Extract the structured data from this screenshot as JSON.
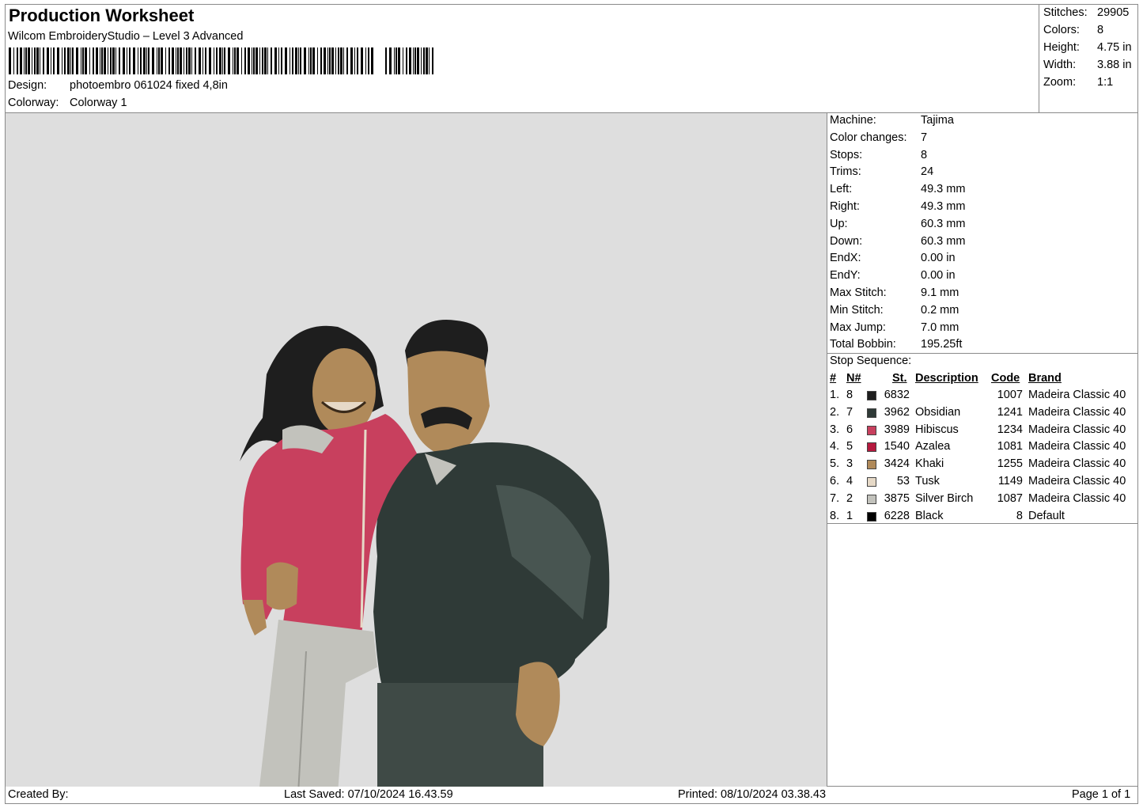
{
  "header": {
    "title": "Production Worksheet",
    "subtitle": "Wilcom EmbroideryStudio – Level 3 Advanced",
    "design_label": "Design:",
    "design_value": "photoembro 061024 fixed  4,8in",
    "colorway_label": "Colorway:",
    "colorway_value": "Colorway 1"
  },
  "stats": [
    {
      "label": "Stitches:",
      "value": "29905"
    },
    {
      "label": "Colors:",
      "value": "8"
    },
    {
      "label": "Height:",
      "value": "4.75 in"
    },
    {
      "label": "Width:",
      "value": "3.88 in"
    },
    {
      "label": "Zoom:",
      "value": "1:1"
    }
  ],
  "machine_info": [
    {
      "label": "Machine:",
      "value": "Tajima"
    },
    {
      "label": "Color changes:",
      "value": "7"
    },
    {
      "label": "Stops:",
      "value": "8"
    },
    {
      "label": "Trims:",
      "value": "24"
    },
    {
      "label": "Left:",
      "value": "49.3 mm"
    },
    {
      "label": "Right:",
      "value": "49.3 mm"
    },
    {
      "label": "Up:",
      "value": "60.3 mm"
    },
    {
      "label": "Down:",
      "value": "60.3 mm"
    },
    {
      "label": "EndX:",
      "value": "0.00 in"
    },
    {
      "label": "EndY:",
      "value": "0.00 in"
    },
    {
      "label": "Max Stitch:",
      "value": "9.1 mm"
    },
    {
      "label": "Min Stitch:",
      "value": "0.2 mm"
    },
    {
      "label": "Max Jump:",
      "value": "7.0 mm"
    },
    {
      "label": "Total Bobbin:",
      "value": "195.25ft"
    }
  ],
  "stop_sequence": {
    "title": "Stop Sequence:",
    "headers": {
      "num": "#",
      "n": "N#",
      "st": "St.",
      "description": "Description",
      "code": "Code",
      "brand": "Brand"
    },
    "rows": [
      {
        "num": "1.",
        "n": "8",
        "color": "#1e1e1e",
        "st": "6832",
        "description": "",
        "code": "1007",
        "brand": "Madeira Classic 40"
      },
      {
        "num": "2.",
        "n": "7",
        "color": "#2f3a37",
        "st": "3962",
        "description": "Obsidian",
        "code": "1241",
        "brand": "Madeira Classic 40"
      },
      {
        "num": "3.",
        "n": "6",
        "color": "#c8405e",
        "st": "3989",
        "description": "Hibiscus",
        "code": "1234",
        "brand": "Madeira Classic 40"
      },
      {
        "num": "4.",
        "n": "5",
        "color": "#b5193e",
        "st": "1540",
        "description": "Azalea",
        "code": "1081",
        "brand": "Madeira Classic 40"
      },
      {
        "num": "5.",
        "n": "3",
        "color": "#b08a5a",
        "st": "3424",
        "description": "Khaki",
        "code": "1255",
        "brand": "Madeira Classic 40"
      },
      {
        "num": "6.",
        "n": "4",
        "color": "#e6d9c7",
        "st": "53",
        "description": "Tusk",
        "code": "1149",
        "brand": "Madeira Classic 40"
      },
      {
        "num": "7.",
        "n": "2",
        "color": "#c2c2bc",
        "st": "3875",
        "description": "Silver Birch",
        "code": "1087",
        "brand": "Madeira Classic 40"
      },
      {
        "num": "8.",
        "n": "1",
        "color": "#000000",
        "st": "6228",
        "description": "Black",
        "code": "8",
        "brand": "Default"
      }
    ]
  },
  "footer": {
    "created_by": "Created By:",
    "last_saved": "Last Saved: 07/10/2024 16.43.59",
    "printed": "Printed: 08/10/2024 03.38.43",
    "page": "Page 1 of 1"
  }
}
